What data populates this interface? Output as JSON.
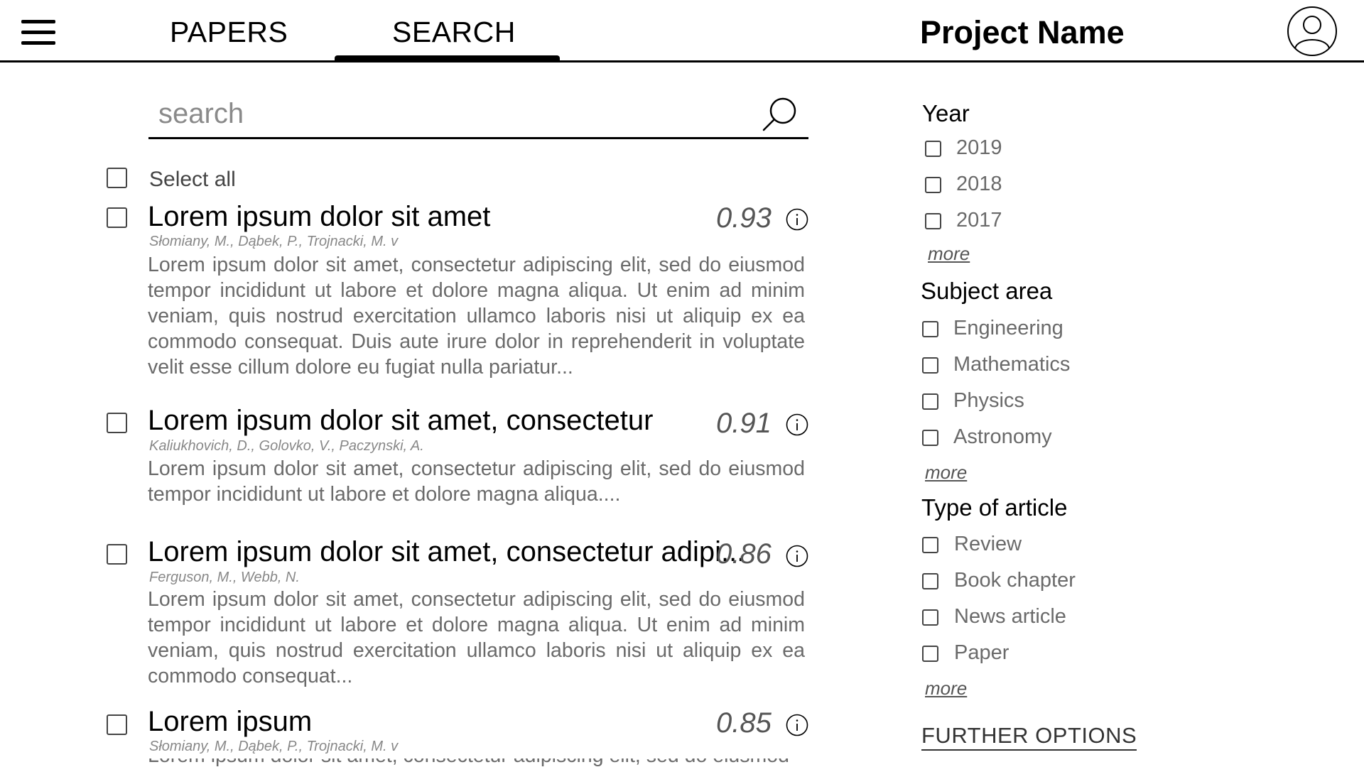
{
  "header": {
    "tabs": [
      {
        "label": "PAPERS"
      },
      {
        "label": "SEARCH",
        "active": true
      }
    ],
    "project_name": "Project Name",
    "menu_icon": "hamburger-menu-icon",
    "avatar_icon": "user-avatar-icon"
  },
  "search": {
    "placeholder": "search",
    "value": "",
    "icon": "search-icon"
  },
  "select_all": {
    "label": "Select all"
  },
  "results": [
    {
      "title": "Lorem ipsum dolor sit amet",
      "authors": "Słomiany, M., Dąbek, P., Trojnacki, M. v",
      "abstract": "Lorem ipsum dolor sit amet, consectetur adipiscing elit, sed do eiusmod tempor incididunt ut labore et dolore magna aliqua. Ut enim ad minim veniam, quis nostrud exercitation ullamco laboris nisi ut aliquip ex ea com­modo consequat. Duis aute irure dolor in reprehenderit in voluptate velit esse cillum dolore eu fugiat nulla pariatur...",
      "score": "0.93"
    },
    {
      "title": "Lorem ipsum dolor sit amet, consectetur",
      "authors": "Kaliukhovich, D., Golovko, V., Paczynski, A.",
      "abstract": "Lorem ipsum dolor sit amet, consectetur adipiscing elit, sed do eiusmod tempor incididunt ut labore et dolore magna aliqua....",
      "score": "0.91"
    },
    {
      "title": "Lorem ipsum dolor sit amet, consectetur adipi...",
      "authors": "Ferguson, M., Webb, N.",
      "abstract": "Lorem ipsum dolor sit amet, consectetur adipiscing elit, sed do eiusmod tempor incididunt ut labore et dolore magna aliqua. Ut enim ad minim veniam, quis nostrud exercitation ullamco laboris nisi ut aliquip ex ea com­modo consequat...",
      "score": "0.86"
    },
    {
      "title": "Lorem ipsum",
      "authors": "Słomiany, M., Dąbek, P., Trojnacki, M. v",
      "abstract": "Lorem ipsum dolor sit amet, consectetur adipiscing elit, sed do eiusmod",
      "score": "0.85"
    }
  ],
  "filters": {
    "year": {
      "heading": "Year",
      "options": [
        "2019",
        "2018",
        "2017"
      ],
      "more": "more"
    },
    "subject": {
      "heading": "Subject area",
      "options": [
        "Engineering",
        "Mathematics",
        "Physics",
        "Astronomy"
      ],
      "more": "more"
    },
    "type": {
      "heading": "Type of article",
      "options": [
        "Review",
        "Book chapter",
        "News article",
        "Paper"
      ],
      "more": "more"
    },
    "further_options": "FURTHER OPTIONS"
  }
}
